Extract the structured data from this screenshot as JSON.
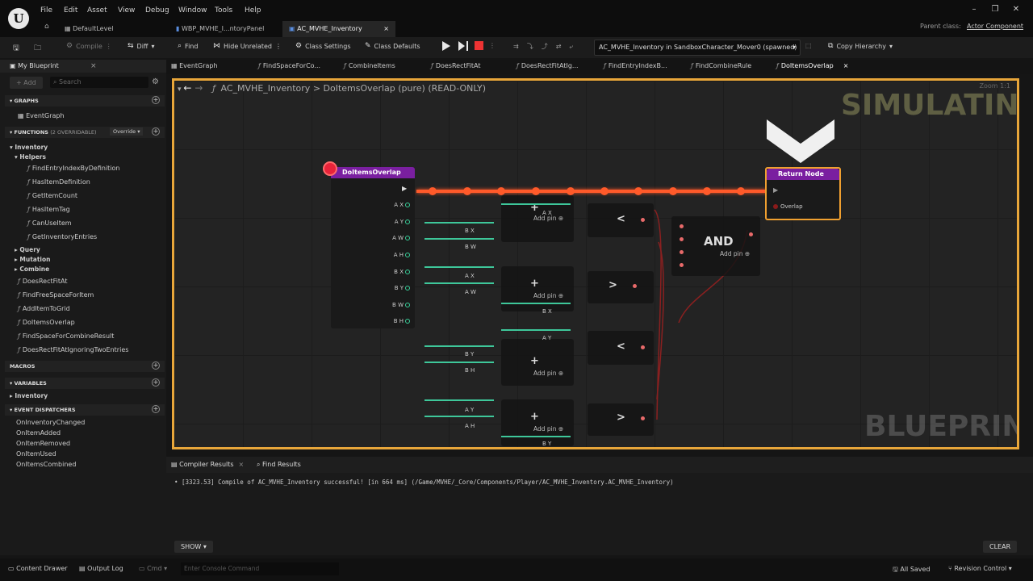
{
  "app": {
    "logo": "U"
  },
  "menu": [
    "File",
    "Edit",
    "Asset",
    "View",
    "Debug",
    "Window",
    "Tools",
    "Help"
  ],
  "doc_tabs": [
    "DefaultLevel",
    "WBP_MVHE_I...ntoryPanel",
    "AC_MVHE_Inventory"
  ],
  "parent_class": {
    "label": "Parent class:",
    "value": "Actor Component"
  },
  "toolbar": {
    "compile": "Compile",
    "diff": "Diff",
    "find": "Find",
    "hide_unrelated": "Hide Unrelated",
    "class_settings": "Class Settings",
    "class_defaults": "Class Defaults",
    "debug_object": "AC_MVHE_Inventory in SandboxCharacter_Mover0 (spawned)",
    "copy_hierarchy": "Copy Hierarchy"
  },
  "left_panel": {
    "title": "My Blueprint",
    "add": "Add",
    "search_placeholder": "Search",
    "graphs": "GRAPHS",
    "event_graph": "EventGraph",
    "functions": "FUNCTIONS",
    "functions_count": "(2 OVERRIDABLE)",
    "override": "Override",
    "cat_inventory": "Inventory",
    "cat_helpers": "Helpers",
    "helpers": [
      "FindEntryIndexByDefinition",
      "HasItemDefinition",
      "GetItemCount",
      "HasItemTag",
      "CanUseItem",
      "GetInventoryEntries"
    ],
    "cat_query": "Query",
    "cat_mutation": "Mutation",
    "cat_combine": "Combine",
    "functions_list": [
      "DoesRectFitAt",
      "FindFreeSpaceForItem",
      "AddItemToGrid",
      "DoItemsOverlap",
      "FindSpaceForCombineResult",
      "DoesRectFitAtIgnoringTwoEntries"
    ],
    "macros": "MACROS",
    "variables": "VARIABLES",
    "var_inventory": "Inventory",
    "event_dispatchers": "EVENT DISPATCHERS",
    "dispatchers": [
      "OnInventoryChanged",
      "OnItemAdded",
      "OnItemRemoved",
      "OnItemUsed",
      "OnItemsCombined"
    ]
  },
  "graph_tabs": [
    "EventGraph",
    "FindSpaceForCo...",
    "CombineItems",
    "DoesRectFitAt",
    "DoesRectFitAtIg...",
    "FindEntryIndexB...",
    "FindCombineRule",
    "DoItemsOverlap"
  ],
  "graph": {
    "breadcrumb_root": "AC_MVHE_Inventory",
    "breadcrumb_sep": ">",
    "breadcrumb_fn": "DoItemsOverlap (pure)",
    "breadcrumb_ro": "(READ-ONLY)",
    "zoom": "Zoom 1:1",
    "simulating": "SIMULATING",
    "blueprint": "BLUEPRINT",
    "entry_node": "DoItemsOverlap",
    "entry_pins": [
      "A X",
      "A Y",
      "A W",
      "A H",
      "B X",
      "B Y",
      "B W",
      "B H"
    ],
    "return_node": "Return Node",
    "return_pin": "Overlap",
    "and_label": "AND",
    "add_pin": "Add pin",
    "lbl_ax": "A X",
    "lbl_ay": "A Y",
    "lbl_aw": "A W",
    "lbl_ah": "A H",
    "lbl_bx": "B X",
    "lbl_by": "B Y",
    "lbl_bw": "B W",
    "lbl_bh": "B H",
    "op_lt": "<",
    "op_gt": ">",
    "op_plus": "+"
  },
  "bottom": {
    "compiler_results": "Compiler Results",
    "find_results": "Find Results",
    "log": "[3323.53] Compile of AC_MVHE_Inventory successful! [in 664 ms] (/Game/MVHE/_Core/Components/Player/AC_MVHE_Inventory.AC_MVHE_Inventory)",
    "show": "SHOW",
    "clear": "CLEAR"
  },
  "status": {
    "content_drawer": "Content Drawer",
    "output_log": "Output Log",
    "cmd": "Cmd",
    "console_placeholder": "Enter Console Command",
    "all_saved": "All Saved",
    "revision_control": "Revision Control"
  }
}
